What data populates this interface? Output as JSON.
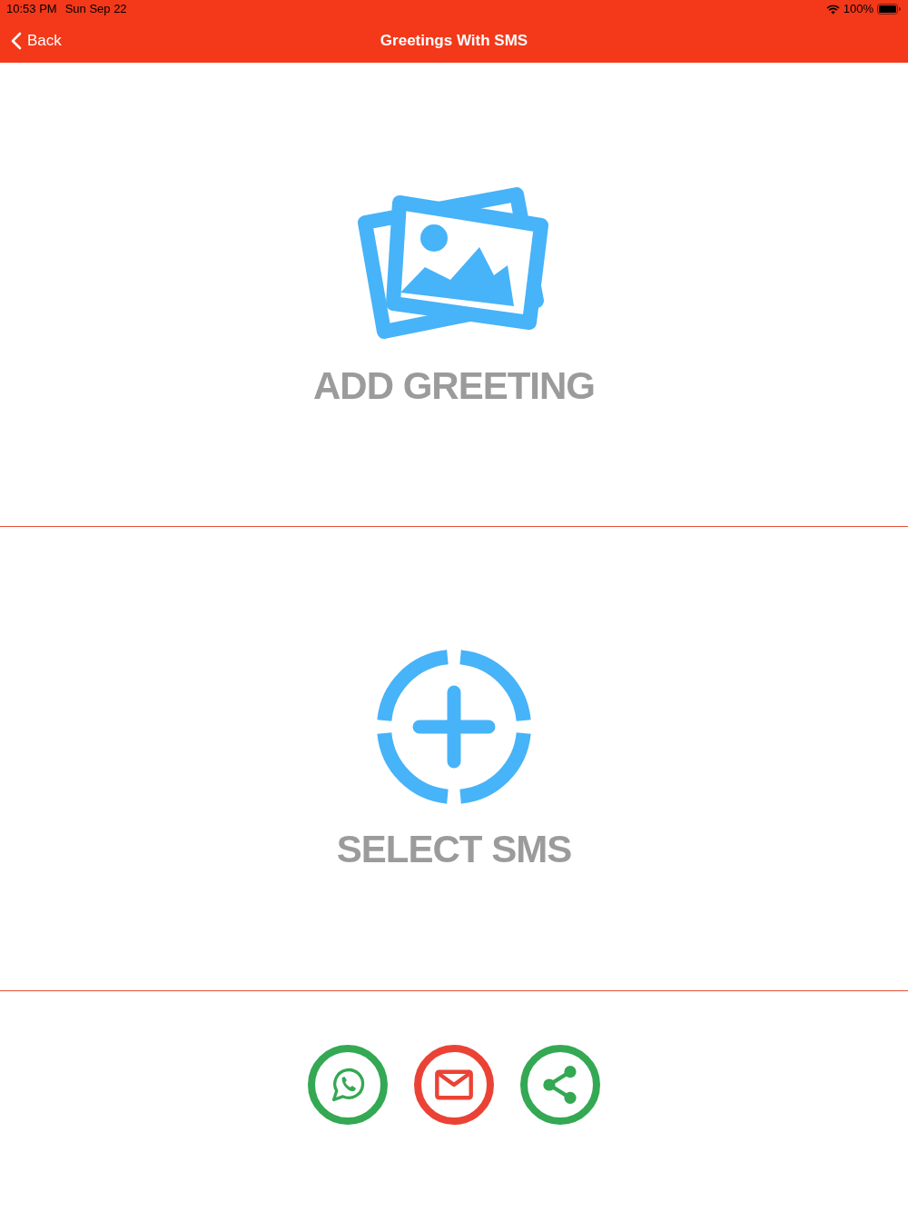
{
  "status_bar": {
    "time": "10:53 PM",
    "date": "Sun Sep 22",
    "battery": "100%"
  },
  "nav_bar": {
    "back_label": "Back",
    "title": "Greetings With SMS"
  },
  "sections": [
    {
      "kind": "image",
      "label": "ADD GREETING"
    },
    {
      "kind": "plus",
      "label": "SELECT SMS"
    }
  ],
  "share_buttons": [
    {
      "kind": "chat",
      "color": "#34a853"
    },
    {
      "kind": "mail",
      "color": "#ea4335"
    },
    {
      "kind": "share",
      "color": "#34a853"
    }
  ]
}
